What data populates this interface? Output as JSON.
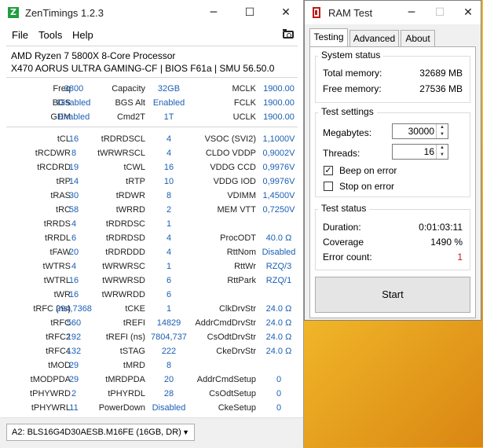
{
  "zentimings": {
    "title": "ZenTimings 1.2.3",
    "icon_letter": "Z",
    "menu": [
      "File",
      "Tools",
      "Help"
    ],
    "cpu": "AMD Ryzen 7 5800X 8-Core Processor",
    "board": "X470 AORUS ULTRA GAMING-CF | BIOS F61a | SMU 56.50.0",
    "top_rows": [
      [
        "Freq",
        "3800",
        "Capacity",
        "32GB",
        "MCLK",
        "1900.00"
      ],
      [
        "BGS",
        "Disabled",
        "BGS Alt",
        "Enabled",
        "FCLK",
        "1900.00"
      ],
      [
        "GDM",
        "Enabled",
        "Cmd2T",
        "1T",
        "UCLK",
        "1900.00"
      ]
    ],
    "rows": [
      [
        "tCL",
        "16",
        "tRDRDSCL",
        "4",
        "VSOC (SVI2)",
        "1,1000V"
      ],
      [
        "tRCDWR",
        "8",
        "tWRWRSCL",
        "4",
        "CLDO VDDP",
        "0,9002V"
      ],
      [
        "tRCDRD",
        "19",
        "tCWL",
        "16",
        "VDDG CCD",
        "0,9976V"
      ],
      [
        "tRP",
        "14",
        "tRTP",
        "10",
        "VDDG IOD",
        "0,9976V"
      ],
      [
        "tRAS",
        "30",
        "tRDWR",
        "8",
        "VDIMM",
        "1,4500V"
      ],
      [
        "tRC",
        "58",
        "tWRRD",
        "2",
        "MEM VTT",
        "0,7250V"
      ],
      [
        "tRRDS",
        "4",
        "tRDRDSC",
        "1",
        "",
        ""
      ],
      [
        "tRRDL",
        "6",
        "tRDRDSD",
        "4",
        "ProcODT",
        "40.0 Ω"
      ],
      [
        "tFAW",
        "20",
        "tRDRDDD",
        "4",
        "RttNom",
        "Disabled"
      ],
      [
        "tWTRS",
        "4",
        "tWRWRSC",
        "1",
        "RttWr",
        "RZQ/3"
      ],
      [
        "tWTRL",
        "16",
        "tWRWRSD",
        "6",
        "RttPark",
        "RZQ/1"
      ],
      [
        "tWR",
        "16",
        "tWRWRDD",
        "6",
        "",
        ""
      ],
      [
        "tRFC (ns)",
        "294,7368",
        "tCKE",
        "1",
        "ClkDrvStr",
        "24.0 Ω"
      ],
      [
        "tRFC",
        "560",
        "tREFI",
        "14829",
        "AddrCmdDrvStr",
        "24.0 Ω"
      ],
      [
        "tRFC2",
        "192",
        "tREFI (ns)",
        "7804,737",
        "CsOdtDrvStr",
        "24.0 Ω"
      ],
      [
        "tRFC4",
        "132",
        "tSTAG",
        "222",
        "CkeDrvStr",
        "24.0 Ω"
      ],
      [
        "tMOD",
        "29",
        "tMRD",
        "8",
        "",
        ""
      ],
      [
        "tMODPDA",
        "29",
        "tMRDPDA",
        "20",
        "AddrCmdSetup",
        "0"
      ],
      [
        "tPHYWRD",
        "2",
        "tPHYRDL",
        "28",
        "CsOdtSetup",
        "0"
      ],
      [
        "tPHYWRL",
        "11",
        "PowerDown",
        "Disabled",
        "CkeSetup",
        "0"
      ]
    ],
    "dimm_select": "A2: BLS16G4D30AESB.M16FE (16GB, DR)"
  },
  "ramtest": {
    "title": "RAM Test",
    "tabs": [
      "Testing",
      "Advanced",
      "About"
    ],
    "system_status": {
      "title": "System status",
      "total_label": "Total memory:",
      "total_value": "32689 MB",
      "free_label": "Free memory:",
      "free_value": "27536 MB"
    },
    "test_settings": {
      "title": "Test settings",
      "megabytes_label": "Megabytes:",
      "megabytes_value": "30000",
      "threads_label": "Threads:",
      "threads_value": "16",
      "beep_label": "Beep on error",
      "beep_checked": true,
      "stop_label": "Stop on error",
      "stop_checked": false
    },
    "test_status": {
      "title": "Test status",
      "duration_label": "Duration:",
      "duration_value": "0:01:03:11",
      "coverage_label": "Coverage",
      "coverage_value": "1490 %",
      "errors_label": "Error count:",
      "errors_value": "1"
    },
    "start_label": "Start"
  },
  "colors": {
    "value_blue": "#1a5fb4",
    "error_red": "#c01818",
    "zt_icon": "#1f9e3e"
  }
}
